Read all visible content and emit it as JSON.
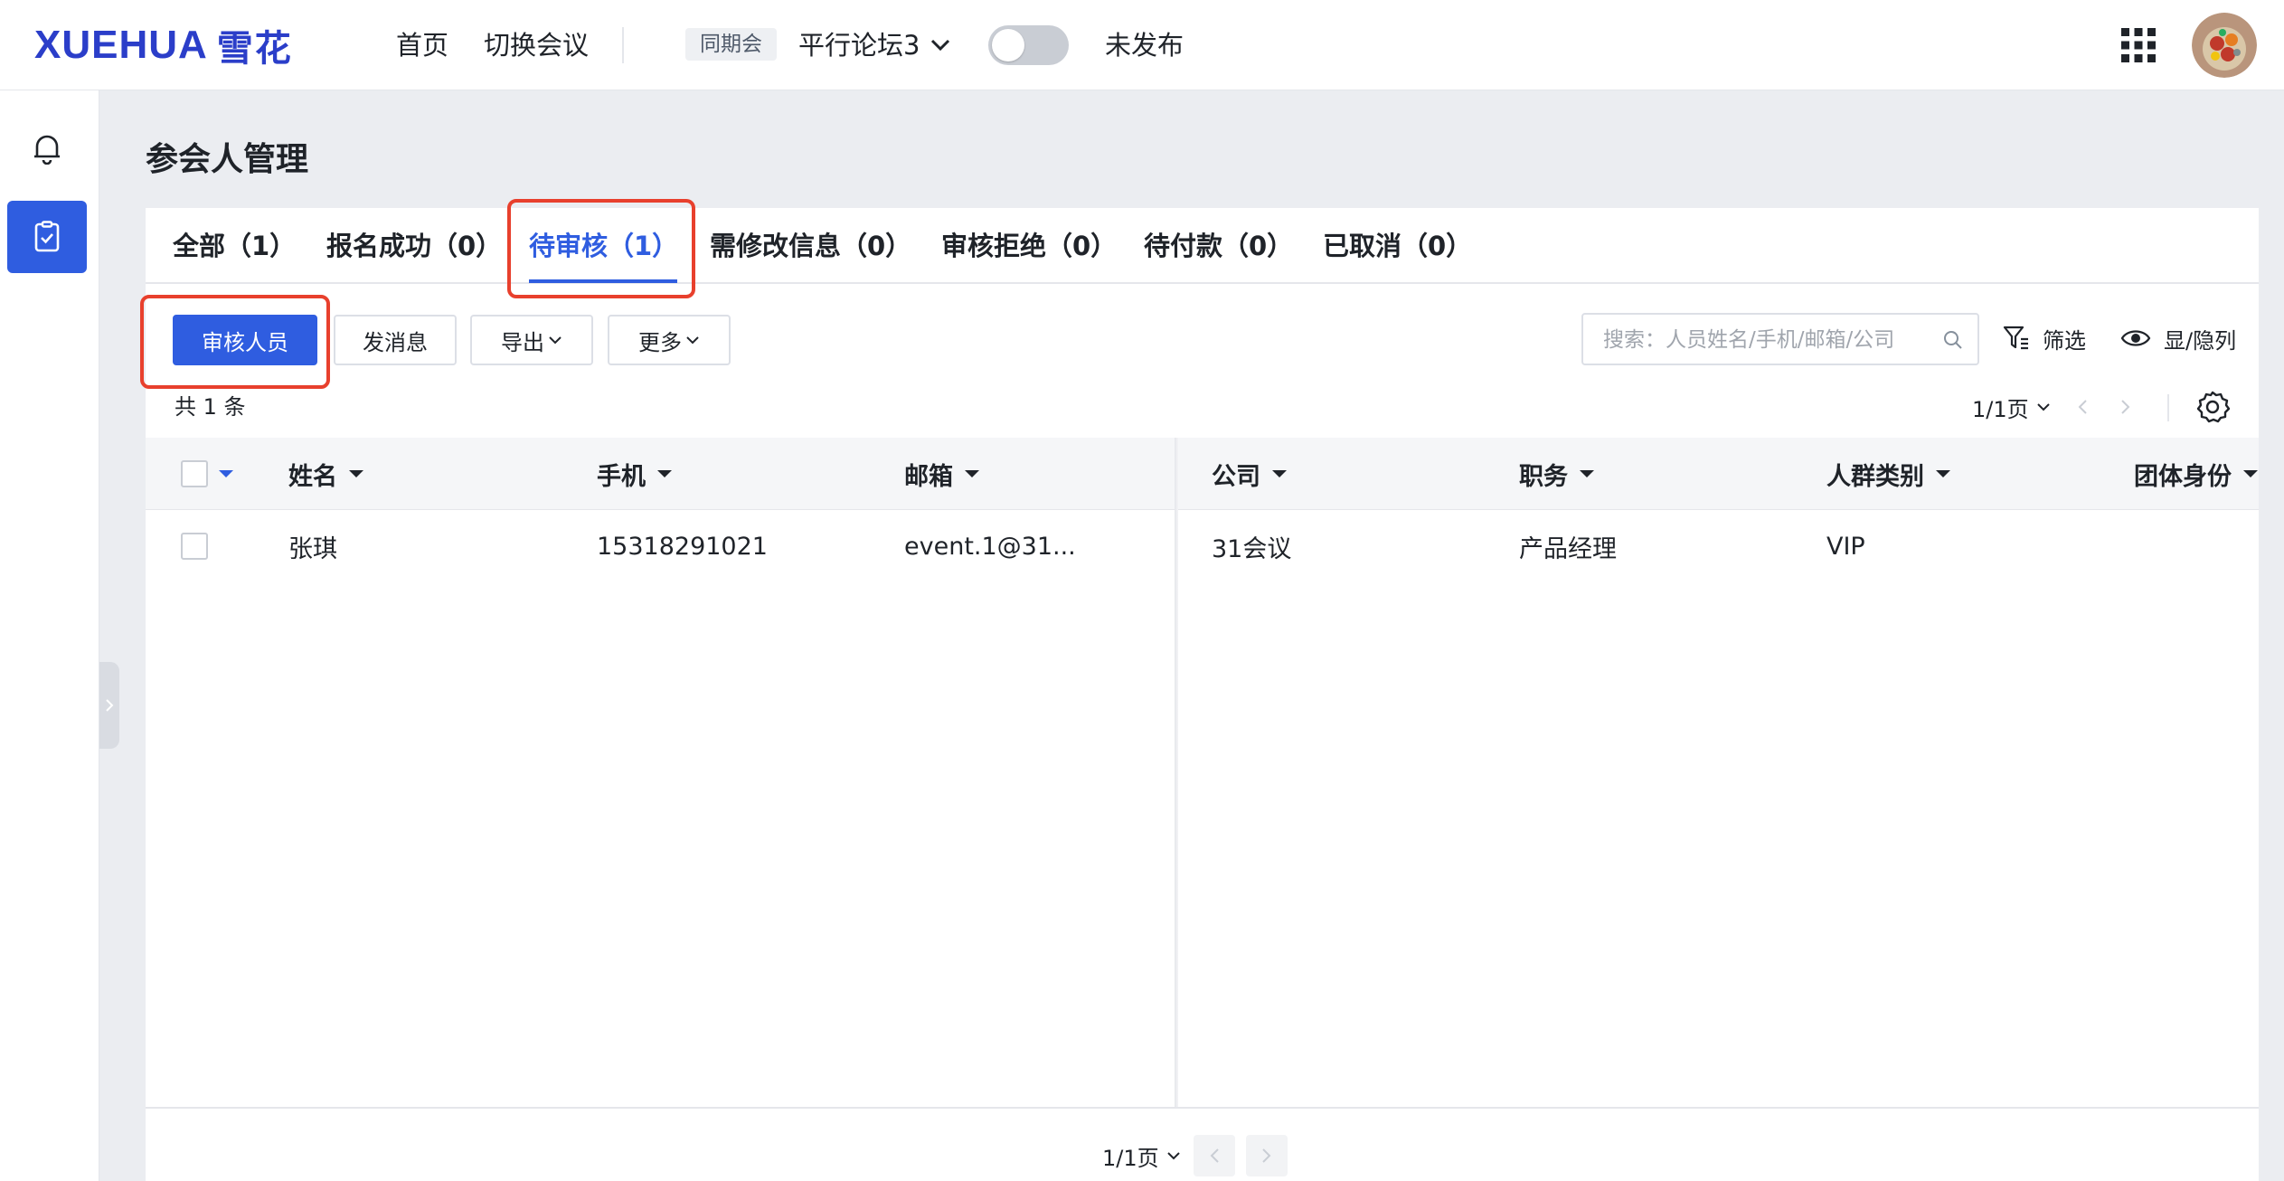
{
  "header": {
    "logo_en": "XUEHUA",
    "logo_cn": "雪花",
    "nav": [
      "首页",
      "切换会议"
    ],
    "concurrent_tag": "同期会",
    "conference": "平行论坛3",
    "publish_toggle": false,
    "publish_status": "未发布",
    "icons": [
      "apps-grid-icon",
      "avatar"
    ]
  },
  "sidebar": {
    "items": [
      {
        "icon": "bell-icon",
        "active": false
      },
      {
        "icon": "clipboard-check-icon",
        "active": true
      }
    ]
  },
  "page": {
    "title": "参会人管理"
  },
  "tabs": [
    {
      "label": "全部（1）"
    },
    {
      "label": "报名成功（0）"
    },
    {
      "label": "待审核（1）",
      "active": true
    },
    {
      "label": "需修改信息（0）"
    },
    {
      "label": "审核拒绝（0）"
    },
    {
      "label": "待付款（0）"
    },
    {
      "label": "已取消（0）"
    }
  ],
  "toolbar": {
    "review_button": "审核人员",
    "message_button": "发消息",
    "export_button": "导出",
    "more_button": "更多",
    "search_placeholder": "搜索：人员姓名/手机/邮箱/公司",
    "filter_label": "筛选",
    "toggle_columns_label": "显/隐列"
  },
  "summary": {
    "total": "共 1 条",
    "page": "1/1页"
  },
  "table": {
    "columns": [
      "姓名",
      "手机",
      "邮箱",
      "公司",
      "职务",
      "人群类别",
      "团体身份"
    ],
    "rows": [
      {
        "name": "张琪",
        "phone": "15318291021",
        "email": "event.1@31...",
        "company": "31会议",
        "title": "产品经理",
        "group": "VIP",
        "team_role": ""
      }
    ]
  },
  "footer": {
    "page": "1/1页"
  },
  "colors": {
    "primary": "#2f5de0",
    "highlight": "#e8402d",
    "background": "#ebedf1"
  }
}
